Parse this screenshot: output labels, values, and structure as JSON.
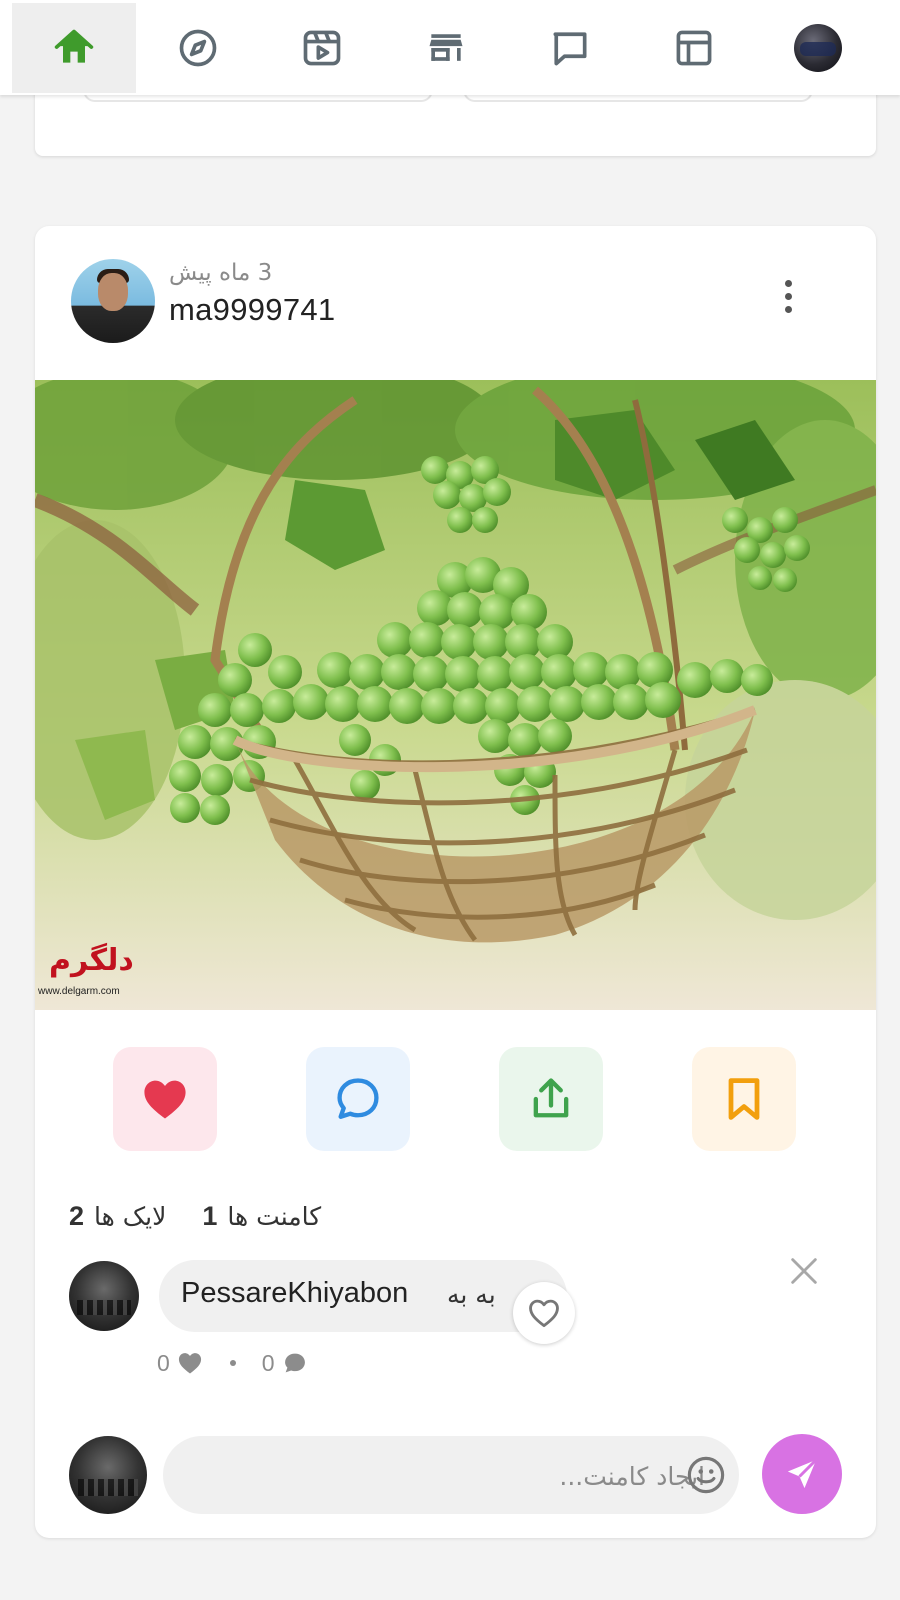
{
  "nav": {
    "items": [
      {
        "name": "home",
        "icon": "home-icon",
        "active": true
      },
      {
        "name": "explore",
        "icon": "compass-icon",
        "active": false
      },
      {
        "name": "videos",
        "icon": "video-icon",
        "active": false
      },
      {
        "name": "store",
        "icon": "store-icon",
        "active": false
      },
      {
        "name": "messages",
        "icon": "chat-icon",
        "active": false
      },
      {
        "name": "layout",
        "icon": "layout-icon",
        "active": false
      },
      {
        "name": "profile",
        "icon": "avatar",
        "active": false
      }
    ],
    "active_color": "#3f9b2c"
  },
  "post": {
    "time": "3 ماه پیش",
    "username": "ma9999741",
    "image": {
      "watermark_url": "www.delgarm.com"
    },
    "actions": {
      "like": {
        "icon": "heart-icon",
        "color": "#e53950"
      },
      "comment": {
        "icon": "comment-icon",
        "color": "#2f8be0"
      },
      "share": {
        "icon": "share-icon",
        "color": "#3fa34d"
      },
      "save": {
        "icon": "bookmark-icon",
        "color": "#f29f0d"
      }
    },
    "stats": {
      "likes_count": "2",
      "likes_label": "لایک ها",
      "comments_count": "1",
      "comments_label": "کامنت ها"
    }
  },
  "comments": [
    {
      "username": "PessareKhiyabon",
      "text": "به به",
      "likes": "0",
      "replies": "0"
    }
  ],
  "composer": {
    "placeholder": "ایجاد کامنت...",
    "send_color": "#d872e3"
  }
}
